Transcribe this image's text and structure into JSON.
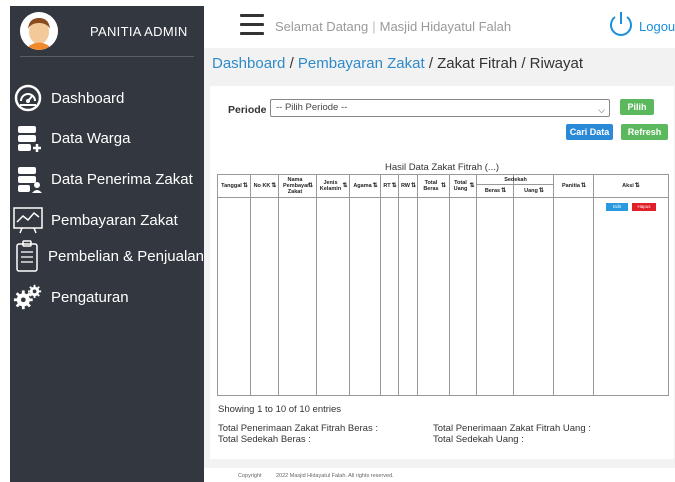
{
  "sidebar": {
    "admin_name": "PANITIA ADMIN",
    "items": [
      {
        "label": "Dashboard",
        "icon": "dashboard-icon"
      },
      {
        "label": "Data Warga",
        "icon": "data-warga-icon"
      },
      {
        "label": "Data Penerima Zakat",
        "icon": "data-penerima-icon"
      },
      {
        "label": "Pembayaran Zakat",
        "icon": "chart-icon"
      },
      {
        "label": "Pembelian & Penjualan",
        "icon": "clipboard-icon"
      },
      {
        "label": "Pengaturan",
        "icon": "gear-icon"
      }
    ]
  },
  "topbar": {
    "welcome": "Selamat Datang",
    "site_name": "Masjid Hidayatul Falah",
    "logout": "Logou"
  },
  "breadcrumb": {
    "dashboard": "Dashboard",
    "pembayaran": "Pembayaran Zakat",
    "rest": "/ Zakat Fitrah / Riwayat"
  },
  "filter": {
    "label": "Periode",
    "select_value": "-- Pilih Periode --",
    "pilih": "Pilih",
    "cari": "Cari Data",
    "refresh": "Refresh"
  },
  "table": {
    "title": "Hasil Data Zakat Fitrah (...)",
    "columns": {
      "tanggal": "Tanggal",
      "no_kk": "No KK",
      "nama": "Nama Pembayar Zakat",
      "jenis": "Jenis Kelamin",
      "agama": "Agama",
      "rt": "RT",
      "rw": "RW",
      "total_beras": "Total Beras",
      "total_uang": "Total Uang",
      "sedekah": "Sedekah",
      "sedekah_beras": "Beras",
      "sedekah_uang": "Uang",
      "panitia": "Panitia",
      "aksi": "Aksi"
    },
    "edit": "Edit",
    "hapus": "Hapus"
  },
  "showing": "Showing 1 to 10 of 10 entries",
  "summary": {
    "fitrah_beras": "Total Penerimaan Zakat Fitrah Beras :",
    "sedekah_beras": "Total Sedekah Beras :",
    "fitrah_uang": "Total Penerimaan Zakat Fitrah Uang :",
    "sedekah_uang": "Total Sedekah Uang :"
  },
  "footer": {
    "copyright": "Copyright",
    "text": "2022 Masjid Hidayatul Falah. All rights reserved."
  },
  "colors": {
    "sidebar": "#33373f",
    "link": "#2e8bc9",
    "green": "#5cb85c",
    "blue": "#2a8ad8",
    "red": "#e01f2a"
  }
}
